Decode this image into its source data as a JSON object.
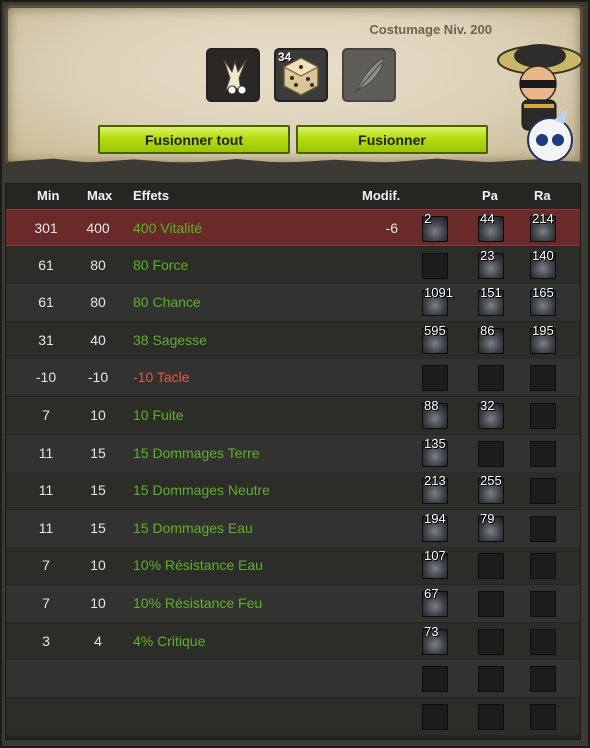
{
  "header": {
    "level_text": "Costumage Niv. 200",
    "slots": [
      {
        "name": "bone-item",
        "count": ""
      },
      {
        "name": "dice-item",
        "count": "34"
      },
      {
        "name": "feather-item",
        "count": ""
      }
    ],
    "buttons": {
      "merge_all": "Fusionner tout",
      "merge": "Fusionner"
    }
  },
  "columns": {
    "min": "Min",
    "max": "Max",
    "effects": "Effets",
    "modif": "Modif.",
    "pa": "Pa",
    "ra": "Ra"
  },
  "rows": [
    {
      "min": "301",
      "max": "400",
      "effect": "400 Vitalité",
      "modif": "-6",
      "color": "green",
      "selected": true,
      "runes": [
        "2",
        "44",
        "214"
      ]
    },
    {
      "min": "61",
      "max": "80",
      "effect": "80 Force",
      "modif": "",
      "color": "green",
      "runes": [
        "",
        "23",
        "140"
      ]
    },
    {
      "min": "61",
      "max": "80",
      "effect": "80 Chance",
      "modif": "",
      "color": "green",
      "runes": [
        "1091",
        "151",
        "165"
      ]
    },
    {
      "min": "31",
      "max": "40",
      "effect": "38 Sagesse",
      "modif": "",
      "color": "green",
      "runes": [
        "595",
        "86",
        "195"
      ]
    },
    {
      "min": "-10",
      "max": "-10",
      "effect": "-10 Tacle",
      "modif": "",
      "color": "red",
      "runes": [
        "",
        "",
        ""
      ]
    },
    {
      "min": "7",
      "max": "10",
      "effect": "10 Fuite",
      "modif": "",
      "color": "green",
      "runes": [
        "88",
        "32",
        ""
      ]
    },
    {
      "min": "11",
      "max": "15",
      "effect": "15 Dommages Terre",
      "modif": "",
      "color": "green",
      "runes": [
        "135",
        "",
        ""
      ]
    },
    {
      "min": "11",
      "max": "15",
      "effect": "15 Dommages Neutre",
      "modif": "",
      "color": "green",
      "runes": [
        "213",
        "255",
        ""
      ]
    },
    {
      "min": "11",
      "max": "15",
      "effect": "15 Dommages Eau",
      "modif": "",
      "color": "green",
      "runes": [
        "194",
        "79",
        ""
      ]
    },
    {
      "min": "7",
      "max": "10",
      "effect": "10% Résistance Eau",
      "modif": "",
      "color": "green",
      "runes": [
        "107",
        "",
        ""
      ]
    },
    {
      "min": "7",
      "max": "10",
      "effect": "10% Résistance Feu",
      "modif": "",
      "color": "green",
      "runes": [
        "67",
        "",
        ""
      ]
    },
    {
      "min": "3",
      "max": "4",
      "effect": "4% Critique",
      "modif": "",
      "color": "green",
      "runes": [
        "73",
        "",
        ""
      ]
    },
    {
      "min": "",
      "max": "",
      "effect": "",
      "modif": "",
      "color": "green",
      "runes": [
        "",
        "",
        ""
      ]
    },
    {
      "min": "",
      "max": "",
      "effect": "",
      "modif": "",
      "color": "green",
      "runes": [
        "",
        "",
        ""
      ]
    }
  ],
  "colors": {
    "accent_green": "#b6dd10",
    "effect_positive": "#5eb128",
    "effect_negative": "#e65a45",
    "selected_row": "#6a2a2a"
  }
}
